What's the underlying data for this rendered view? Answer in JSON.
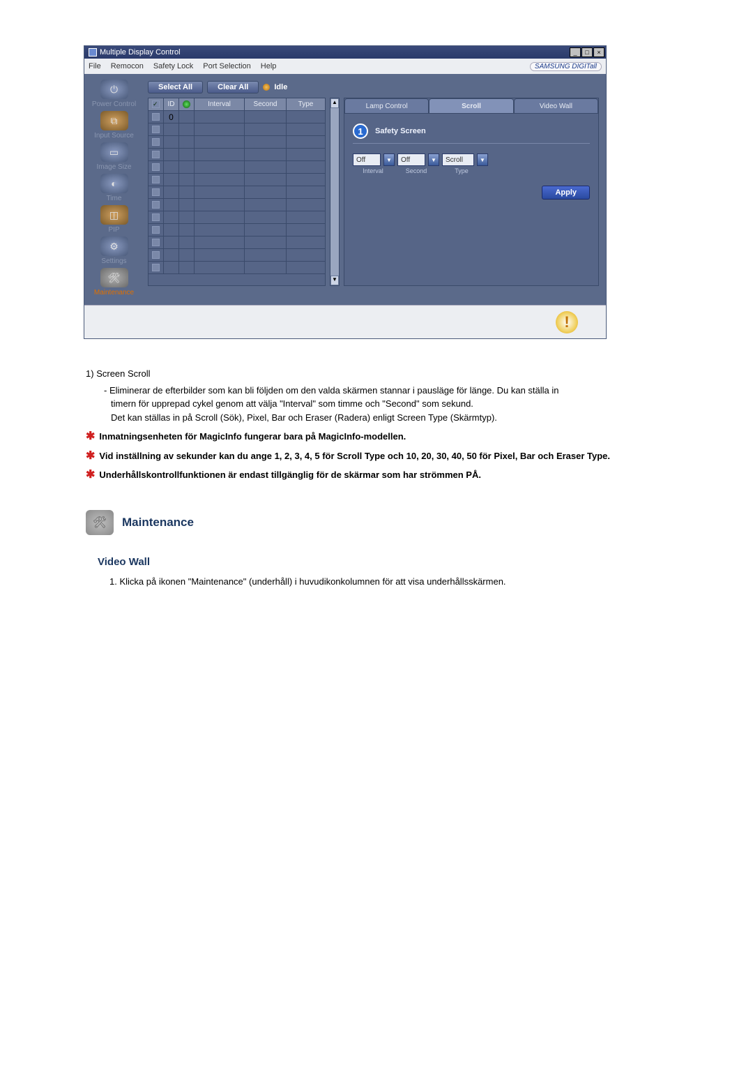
{
  "window": {
    "title": "Multiple Display Control",
    "menu": [
      "File",
      "Remocon",
      "Safety Lock",
      "Port Selection",
      "Help"
    ],
    "brand": "SAMSUNG DIGITall"
  },
  "sidebar": {
    "items": [
      {
        "label": "Power Control"
      },
      {
        "label": "Input Source"
      },
      {
        "label": "Image Size"
      },
      {
        "label": "Time"
      },
      {
        "label": "PIP"
      },
      {
        "label": "Settings"
      },
      {
        "label": "Maintenance"
      }
    ]
  },
  "toolbar": {
    "select_all": "Select All",
    "clear_all": "Clear All",
    "idle": "Idle"
  },
  "table": {
    "headers": {
      "id": "ID",
      "interval": "Interval",
      "second": "Second",
      "type": "Type"
    },
    "rows": [
      {
        "checked": true,
        "id": "0",
        "power": true
      }
    ],
    "blank_rows": 12
  },
  "right": {
    "tabs": {
      "lamp": "Lamp Control",
      "scroll": "Scroll",
      "video": "Video Wall"
    },
    "callout": "1",
    "safety_title": "Safety Screen",
    "dd1": "Off",
    "dd2": "Off",
    "dd3": "Scroll",
    "sub1": "Interval",
    "sub2": "Second",
    "sub3": "Type",
    "apply": "Apply"
  },
  "doc": {
    "item1_num": "1)",
    "item1_title": "Screen Scroll",
    "item1_line1": "- Eliminerar de efterbilder som kan bli följden om den valda skärmen stannar i pausläge för länge. Du kan ställa in",
    "item1_line2": "timern för upprepad cykel genom att välja \"Interval\" som timme och \"Second\" som sekund.",
    "item1_line3": "Det kan ställas in på Scroll (Sök), Pixel, Bar och Eraser (Radera) enligt Screen Type (Skärmtyp).",
    "star1": "Inmatningsenheten för MagicInfo fungerar bara på MagicInfo-modellen.",
    "star2": "Vid inställning av sekunder kan du ange 1, 2, 3, 4, 5 för Scroll Type och 10, 20, 30, 40, 50 för Pixel, Bar och Eraser Type.",
    "star3": "Underhållskontrollfunktionen är endast tillgänglig för de skärmar som har strömmen PÅ.",
    "section_title": "Maintenance",
    "subsection_title": "Video Wall",
    "sub_item1": "1. Klicka på ikonen \"Maintenance\" (underhåll) i huvudikonkolumnen för att visa underhållsskärmen."
  }
}
